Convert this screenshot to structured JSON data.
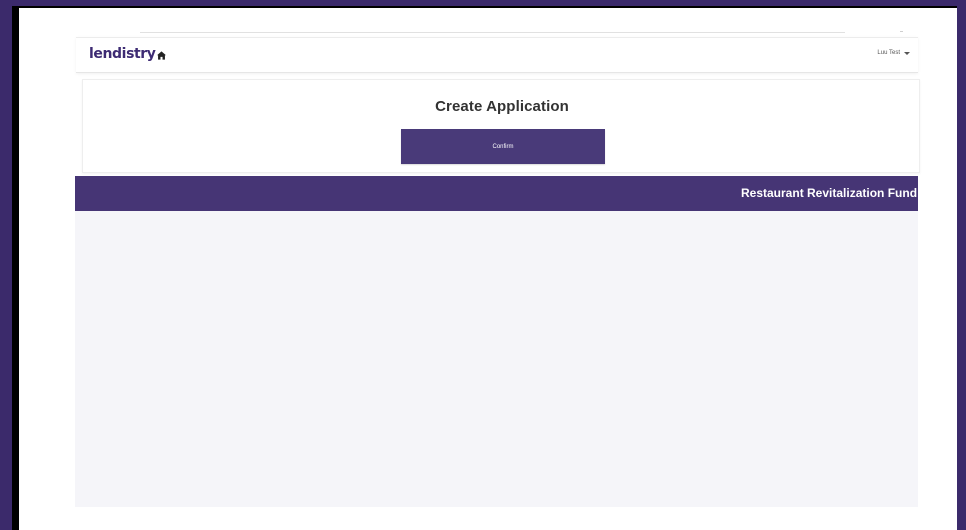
{
  "header": {
    "logo_text": "lendistry",
    "home_icon": "home-icon",
    "user_name": "Luu Test",
    "user_menu_icon": "chevron-down-icon"
  },
  "create_application": {
    "title": "Create Application",
    "confirm_label": "Confirm"
  },
  "banner": {
    "title": "Restaurant Revitalization Fund"
  },
  "colors": {
    "brand_purple": "#463575",
    "button_purple": "#493a79",
    "page_background": "#f5f5f9",
    "outer_background": "#3b2a6b"
  }
}
